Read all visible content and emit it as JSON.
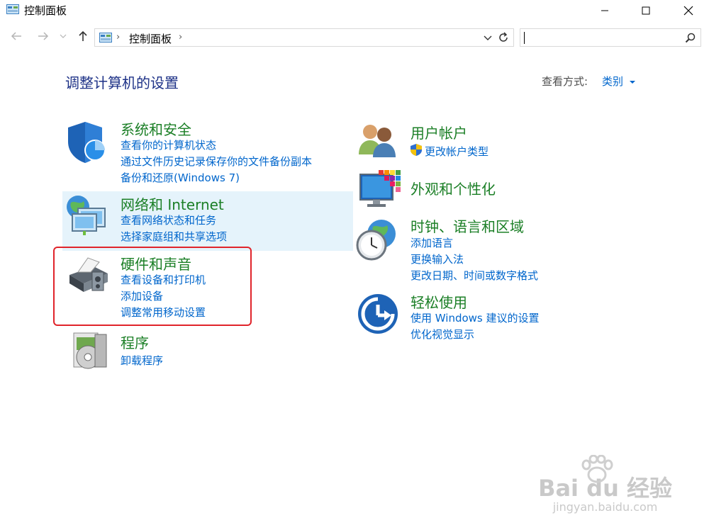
{
  "window": {
    "title": "控制面板",
    "controls": {
      "minimize": "—",
      "maximize": "☐",
      "close": "✕"
    }
  },
  "addressbar": {
    "breadcrumb": "控制面板",
    "search_value": ""
  },
  "main": {
    "heading": "调整计算机的设置",
    "view_by_label": "查看方式:",
    "view_by_value": "类别"
  },
  "categories": {
    "system": {
      "title": "系统和安全",
      "links": [
        "查看你的计算机状态",
        "通过文件历史记录保存你的文件备份副本",
        "备份和还原(Windows 7)"
      ]
    },
    "network": {
      "title": "网络和 Internet",
      "links": [
        "查看网络状态和任务",
        "选择家庭组和共享选项"
      ]
    },
    "hardware": {
      "title": "硬件和声音",
      "links": [
        "查看设备和打印机",
        "添加设备",
        "调整常用移动设置"
      ]
    },
    "programs": {
      "title": "程序",
      "links": [
        "卸载程序"
      ]
    },
    "accounts": {
      "title": "用户帐户",
      "links": [
        "更改帐户类型"
      ]
    },
    "appearance": {
      "title": "外观和个性化",
      "links": []
    },
    "clock": {
      "title": "时钟、语言和区域",
      "links": [
        "添加语言",
        "更换输入法",
        "更改日期、时间或数字格式"
      ]
    },
    "ease": {
      "title": "轻松使用",
      "links": [
        "使用 Windows 建议的设置",
        "优化视觉显示"
      ]
    }
  },
  "watermark": {
    "brand": "Bai du 经验",
    "url": "jingyan.baidu.com"
  },
  "colors": {
    "category_green": "#1b7f26",
    "link_blue": "#0066cc",
    "heading_blue": "#1e3287",
    "highlight_red": "#e0242b"
  }
}
